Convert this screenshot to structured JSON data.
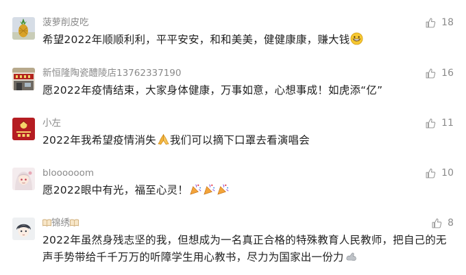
{
  "colors": {
    "nickname": "#8a8a8a",
    "text": "#1f1f1f",
    "like_icon": "#9a9a9a",
    "background": "#ffffff"
  },
  "comments": [
    {
      "nickname": "菠萝削皮吃",
      "text": "希望2022年顺顺利利，平平安安，和和美美，健健康康，赚大钱",
      "likes": "18",
      "avatar_icon": "pineapple-avatar",
      "emoji": "grinning-emoji"
    },
    {
      "nickname": "新恒隆陶瓷醴陵店13762337190",
      "text": "愿2022年疫情结束，大家身体健康，万事如意，心想事成！如虎添“亿”",
      "likes": "16",
      "avatar_icon": "storefront-avatar"
    },
    {
      "nickname": "小左",
      "text_before": "2022年我希望疫情消失",
      "text_after": "我们可以摘下口罩去看演唱会",
      "likes": "11",
      "avatar_icon": "red-seal-avatar",
      "emoji": "praying-hands-emoji"
    },
    {
      "nickname": "bloooooom",
      "text": "愿2022眼中有光，福至心灵！",
      "likes": "10",
      "avatar_icon": "anime-girl-avatar",
      "emoji": "party-popper-emoji"
    },
    {
      "nickname": "锦绣",
      "text": "2022年虽然身残志坚的我，但想成为一名真正合格的特殊教育人民教师，把自己的无声手势带给千千万万的听障学生用心教书，尽力为国家出一份力",
      "likes": "8",
      "avatar_icon": "anime-boy-avatar",
      "emoji": "flexed-arm-emoji"
    }
  ]
}
